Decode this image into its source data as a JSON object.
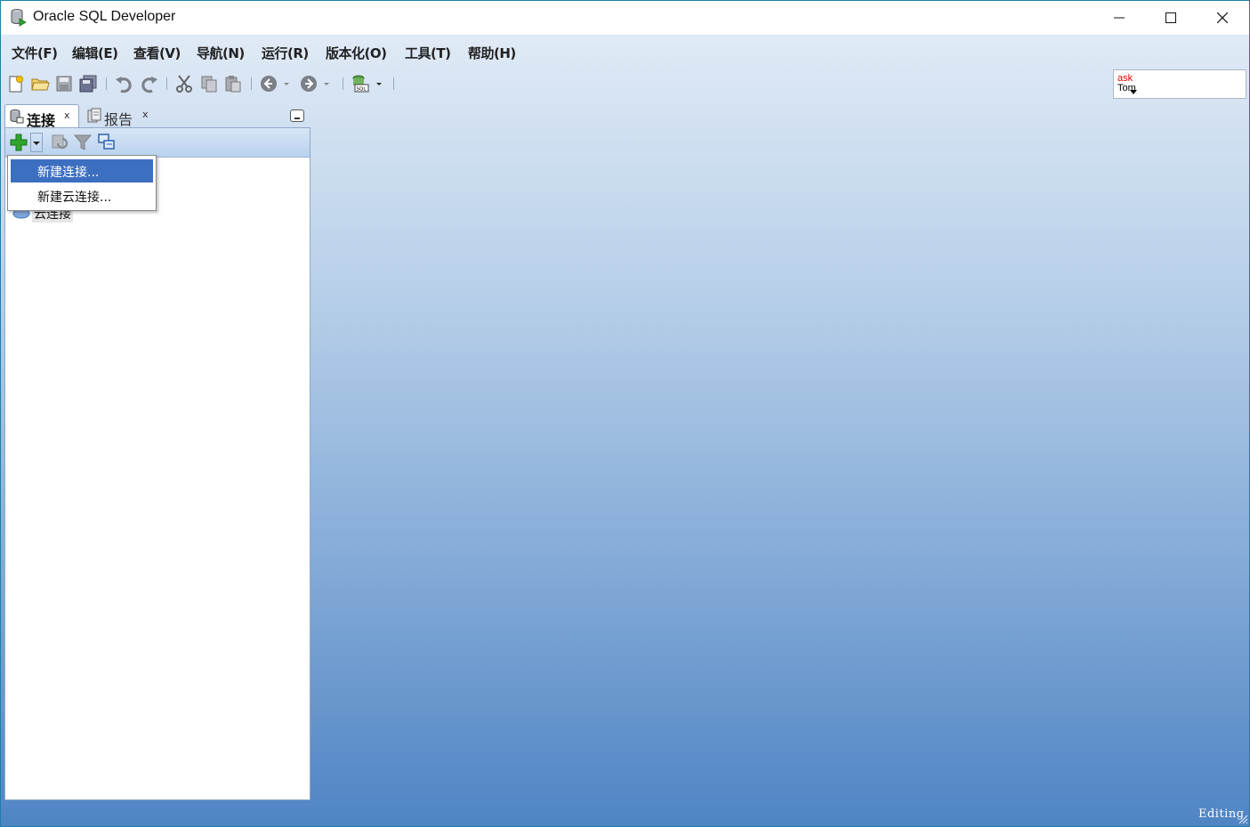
{
  "window": {
    "title": "Oracle SQL Developer"
  },
  "menu": {
    "items": [
      "文件(F)",
      "编辑(E)",
      "查看(V)",
      "导航(N)",
      "运行(R)",
      "版本化(O)",
      "工具(T)",
      "帮助(H)"
    ]
  },
  "asktom": {
    "line1": "ask",
    "line2": "Tom"
  },
  "tabs": {
    "connections": {
      "label": "连接",
      "close": "x"
    },
    "reports": {
      "label": "报告",
      "close": "x"
    }
  },
  "tree": {
    "item_label": "云连接"
  },
  "dropdown": {
    "items": [
      "新建连接...",
      "新建云连接..."
    ]
  },
  "status": {
    "text": "Editing"
  },
  "colors": {
    "menu_highlight": "#3d6fc1",
    "gradient_top": "#e7eff8",
    "gradient_bottom": "#4f84c4",
    "add_icon_green": "#2fa52f"
  },
  "icons": [
    "app-db-icon",
    "new-file-icon",
    "open-folder-icon",
    "save-icon",
    "save-all-icon",
    "undo-icon",
    "redo-icon",
    "cut-icon",
    "copy-icon",
    "paste-icon",
    "back-icon",
    "forward-icon",
    "sql-worksheet-icon",
    "add-icon",
    "refresh-icon",
    "filter-icon",
    "schema-browser-icon",
    "cloud-icon"
  ]
}
